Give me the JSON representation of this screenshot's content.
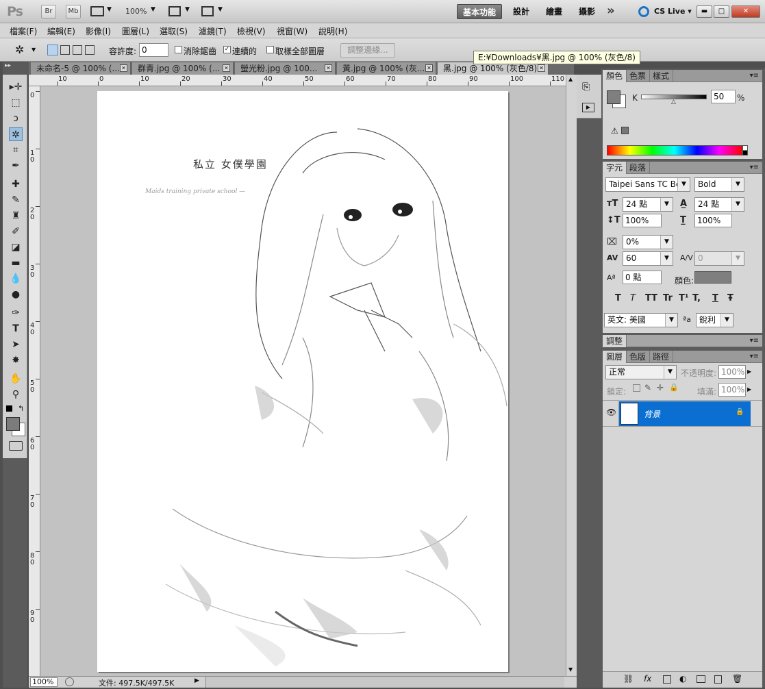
{
  "app": {
    "logo": "Ps",
    "bridge": "Br",
    "minibridge": "Mb",
    "zoom": "100%",
    "workspaces": [
      "基本功能",
      "設計",
      "繪畫",
      "攝影"
    ],
    "more": "»",
    "cslive": "CS Live"
  },
  "menu": [
    "檔案(F)",
    "編輯(E)",
    "影像(I)",
    "圖層(L)",
    "選取(S)",
    "濾鏡(T)",
    "檢視(V)",
    "視窗(W)",
    "說明(H)"
  ],
  "options": {
    "tolerance_label": "容許度:",
    "tolerance_value": "0",
    "antialias": "消除鋸齒",
    "contiguous": "連續的",
    "sample_all": "取樣全部圖層",
    "refine_edge": "調整邊緣..."
  },
  "tabs": [
    "未命名-5 @ 100% (...",
    "群青.jpg @ 100% (...",
    "螢光粉.jpg @ 100...",
    "黃.jpg @ 100% (灰...",
    "黑.jpg @ 100% (灰色/8)"
  ],
  "tooltip": "E:¥Downloads¥黑.jpg @ 100% (灰色/8)",
  "ruler_top": [
    "10",
    "0",
    "10",
    "20",
    "30",
    "40",
    "50",
    "60",
    "70",
    "80",
    "90",
    "100",
    "110"
  ],
  "ruler_left": [
    "0",
    "1 0",
    "2 0",
    "3 0",
    "4 0",
    "5 0",
    "6 0",
    "7 0",
    "8 0",
    "9 0"
  ],
  "artwork": {
    "title": "私立 女僕學園",
    "subtitle": "Maids training private school —"
  },
  "status": {
    "zoom": "100%",
    "doc_size": "文件: 497.5K/497.5K"
  },
  "color_panel": {
    "tabs": [
      "顏色",
      "色票",
      "樣式"
    ],
    "channel": "K",
    "value": "50",
    "unit": "%",
    "gray_level": 0.5
  },
  "char_panel": {
    "tabs": [
      "字元",
      "段落"
    ],
    "font": "Taipei Sans TC Beta",
    "style": "Bold",
    "size": "24 點",
    "leading": "24 點",
    "vscale": "100%",
    "hscale": "100%",
    "tsume": "0%",
    "tracking": "60",
    "kerning": "0",
    "baseline": "0 點",
    "color_label": "顏色:",
    "language": "英文: 美國",
    "aa_label": "a",
    "aa": "銳利",
    "type_buttons": [
      "T",
      "T",
      "TT",
      "Tr",
      "T¹",
      "T,",
      "T",
      "Ŧ"
    ]
  },
  "adjust_panel": {
    "title": "調整"
  },
  "layers_panel": {
    "tabs": [
      "圖層",
      "色版",
      "路徑"
    ],
    "blend": "正常",
    "opacity_label": "不透明度:",
    "opacity": "100%",
    "lock_label": "鎖定:",
    "fill_label": "填滿:",
    "fill": "100%",
    "layer_name": "背景"
  },
  "colors": {
    "accent": "#0a6fd1",
    "panel": "#d6d6d6"
  }
}
